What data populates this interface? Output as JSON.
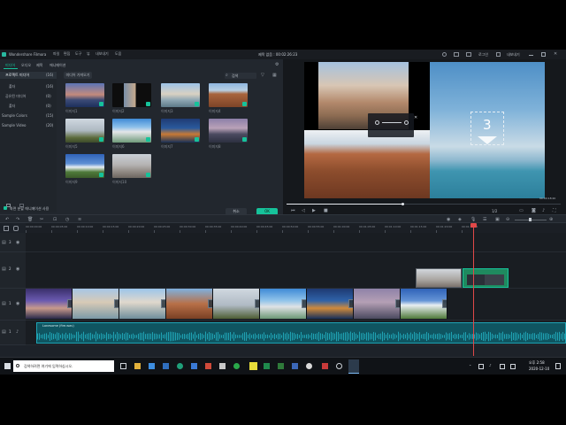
{
  "app": {
    "title": "Wondershare Filmora",
    "menu": [
      "파일",
      "편집",
      "도구",
      "뷰",
      "내보내기",
      "도움"
    ],
    "project_title": "제목 없음 : 00:02:26:23",
    "right_labels": [
      "로그인",
      "내보내기"
    ]
  },
  "media": {
    "tabs": [
      "미디어",
      "오디오",
      "제목",
      "애니메이션"
    ],
    "import_button": "미디어 가져오기",
    "search_placeholder": "검색",
    "sidebar": [
      {
        "label": "프로젝트 미디어",
        "count": "(16)"
      },
      {
        "label": "폴더",
        "count": "(16)"
      },
      {
        "label": "공유된 미디어",
        "count": "(0)"
      },
      {
        "label": "폴더",
        "count": "(0)"
      },
      {
        "label": "Sample Colors",
        "count": "(15)"
      },
      {
        "label": "Sample Video",
        "count": "(20)"
      }
    ],
    "thumbs": [
      {
        "label": "이미지1"
      },
      {
        "label": "이미지2"
      },
      {
        "label": "이미지3"
      },
      {
        "label": "이미지4"
      },
      {
        "label": "이미지5"
      },
      {
        "label": "이미지6"
      },
      {
        "label": "이미지7"
      },
      {
        "label": "이미지8"
      },
      {
        "label": "이미지9"
      },
      {
        "label": "이미지10"
      }
    ],
    "checkbox_label": "화면 분할 애니메이션 사용",
    "cancel_button": "취소",
    "ok_button": "OK"
  },
  "preview": {
    "countdown_number": "3",
    "zoom": "1/2",
    "time": "00:00:18:20"
  },
  "timeline": {
    "ruler_ticks": [
      "00:00:00:00",
      "00:00:05:00",
      "00:00:10:00",
      "00:00:15:00",
      "00:00:20:00",
      "00:00:25:00",
      "00:00:30:00",
      "00:00:35:00",
      "00:00:40:00",
      "00:00:45:00",
      "00:00:50:00",
      "00:00:55:00",
      "00:01:00:00",
      "00:01:05:00",
      "00:01:10:00",
      "00:01:15:00",
      "00:01:20:00",
      "00:01:25:00"
    ],
    "audio_label": "Lonesome (fire.wav)",
    "track_numbers": [
      "3",
      "2",
      "1",
      "1"
    ]
  },
  "taskbar": {
    "search_placeholder": "검색하려면 여기에 입력하십시오.",
    "time": "오후 2:58",
    "date": "2020-12-10"
  },
  "colors": {
    "accent": "#16c29a",
    "playhead": "#e04848",
    "audio_wave": "#1fa3b4"
  }
}
